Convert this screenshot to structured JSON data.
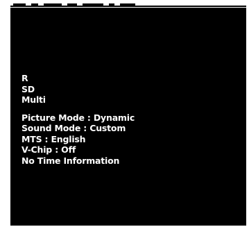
{
  "signal_info": {
    "audio_channel": "R",
    "resolution": "SD",
    "audio_mode": "Multi"
  },
  "settings": {
    "picture_mode": "Picture Mode : Dynamic",
    "sound_mode": "Sound Mode : Custom",
    "mts": "MTS : English",
    "v_chip": "V-Chip : Off",
    "time_info": "No Time Information"
  },
  "colors": {
    "screen_bg": "#000000",
    "text": "#ffffff",
    "page_bg": "#ffffff"
  }
}
